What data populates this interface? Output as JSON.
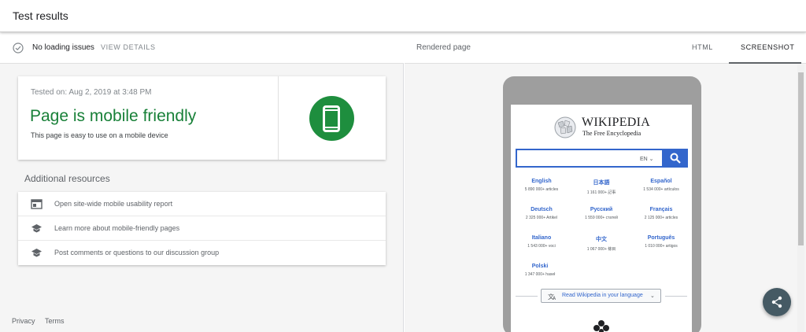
{
  "header": {
    "title": "Test results"
  },
  "status": {
    "text": "No loading issues",
    "view_details": "VIEW DETAILS"
  },
  "result": {
    "tested_on": "Tested on: Aug 2, 2019 at 3:48 PM",
    "headline": "Page is mobile friendly",
    "subtext": "This page is easy to use on a mobile device",
    "accent_color": "#188038"
  },
  "additional": {
    "title": "Additional resources",
    "items": [
      {
        "label": "Open site-wide mobile usability report",
        "icon": "report-icon"
      },
      {
        "label": "Learn more about mobile-friendly pages",
        "icon": "school-icon"
      },
      {
        "label": "Post comments or questions to our discussion group",
        "icon": "school-icon"
      }
    ]
  },
  "footer": {
    "privacy": "Privacy",
    "terms": "Terms"
  },
  "rendered": {
    "title": "Rendered page",
    "tabs": [
      {
        "label": "HTML"
      },
      {
        "label": "SCREENSHOT",
        "active": true
      }
    ]
  },
  "wiki": {
    "wordmark": "WIKIPEDIA",
    "tagline": "The Free Encyclopedia",
    "search_lang": "EN",
    "languages": [
      {
        "name": "English",
        "count": "5 890 000+ articles"
      },
      {
        "name": "日本語",
        "count": "1 161 000+ 記事"
      },
      {
        "name": "Español",
        "count": "1 534 000+ artículos"
      },
      {
        "name": "Deutsch",
        "count": "2 325 000+ Artikel"
      },
      {
        "name": "Русский",
        "count": "1 559 000+ статей"
      },
      {
        "name": "Français",
        "count": "2 125 000+ articles"
      },
      {
        "name": "Italiano",
        "count": "1 543 000+ voci"
      },
      {
        "name": "中文",
        "count": "1 067 000+ 條目"
      },
      {
        "name": "Português",
        "count": "1 010 000+ artigos"
      },
      {
        "name": "Polski",
        "count": "1 347 000+ haseł"
      }
    ],
    "read_button": "Read Wikipedia in your language",
    "link_color": "#3366cc"
  }
}
